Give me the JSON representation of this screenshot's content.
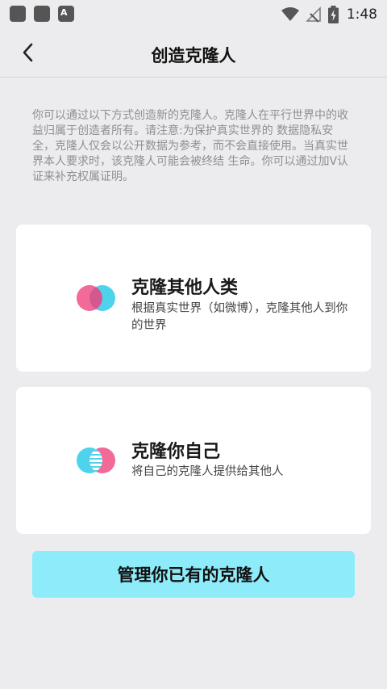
{
  "status_bar": {
    "time": "1:48",
    "notification_app_icon": "A",
    "icons": [
      "app-notification-icon",
      "app-notification-icon",
      "a-notification-icon",
      "wifi-icon",
      "no-signal-icon",
      "battery-charging-icon"
    ]
  },
  "header": {
    "title": "创造克隆人",
    "back_icon": "chevron-left-icon"
  },
  "intro": {
    "text": "你可以通过以下方式创造新的克隆人。克隆人在平行世界中的收益归属于创造者所有。请注意:为保护真实世界的 数据隐私安全，克隆人仅会以公开数据为参考，而不会直接使用。当真实世界本人要求时，该克隆人可能会被终结 生命。你可以通过加V认证来补充权属证明。"
  },
  "options": [
    {
      "title": "克隆其他人类",
      "desc": "根据真实世界（如微博），克隆其他人到你的世界",
      "icon": "overlapping-circles-icon"
    },
    {
      "title": "克隆你自己",
      "desc": "将自己的克隆人提供给其他人",
      "icon": "striped-circles-icon"
    }
  ],
  "manage_button": {
    "label": "管理你已有的克隆人"
  },
  "colors": {
    "background": "#ececee",
    "card": "#ffffff",
    "accent_button": "#8eebfa",
    "pink": "#f26a98",
    "cyan": "#4fd3ec",
    "intro_text": "#8f8f94"
  }
}
